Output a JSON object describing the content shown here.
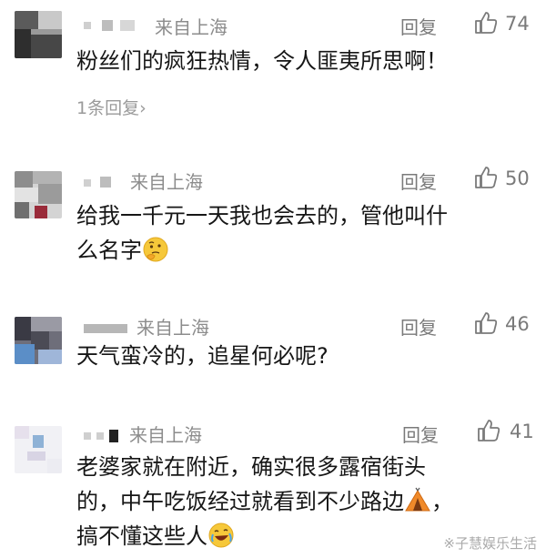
{
  "comments": [
    {
      "location": "来自上海",
      "reply_label": "回复",
      "likes": "74",
      "text": "粉丝们的疯狂热情，令人匪夷所思啊！",
      "replies_link": "1条回复",
      "replies_chevron": "›"
    },
    {
      "location": "来自上海",
      "reply_label": "回复",
      "likes": "50",
      "text_line1": "给我一千元一天我也会去的，管他叫什",
      "text_line2": "么名字",
      "emoji": "thinking-face-emoji"
    },
    {
      "location": "来自上海",
      "reply_label": "回复",
      "likes": "46",
      "text": "天气蛮冷的，追星何必呢?"
    },
    {
      "location": "来自上海",
      "reply_label": "回复",
      "likes": "41",
      "text_line1": "老婆家就在附近，确实很多露宿街头",
      "text_line2": "的，中午吃饭经过就看到不少路边",
      "text_line2_end": "，",
      "text_line3": "搞不懂这些人",
      "emoji_tent": "tent-emoji",
      "emoji_laugh": "rolling-laughing-emoji"
    }
  ],
  "watermark": "※子慧娱乐生活",
  "colors": {
    "meta": "#8c8c8c",
    "text": "#161616",
    "link": "#9a9a9a"
  }
}
